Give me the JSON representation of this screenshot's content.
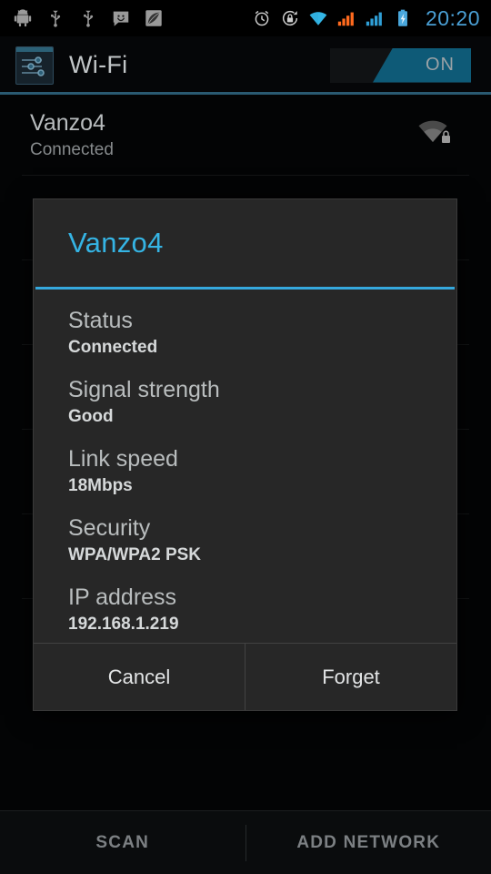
{
  "statusbar": {
    "left_icons": [
      "android-debug-icon",
      "usb-icon",
      "usb-icon-2",
      "sms-smiley-icon",
      "leaf-icon"
    ],
    "right_icons": [
      "alarm-clock-icon",
      "rotation-lock-icon",
      "wifi-signal-icon",
      "cell-signal-sim1-icon",
      "cell-signal-sim2-icon",
      "battery-charging-icon"
    ],
    "clock": "20:20",
    "clock_color": "#4a9fd4",
    "wifi_icon_color": "#33b5e5",
    "sim1_color": "#ff6a1e",
    "sim2_color": "#2f9fd6",
    "battery_color": "#4aa8dd"
  },
  "header": {
    "icon": "wifi-settings-sliders-icon",
    "title": "Wi-Fi",
    "toggle": {
      "label": "ON",
      "state": "on",
      "accent": "#0e5a77"
    },
    "divider_color": "#2a5a72"
  },
  "networks": [
    {
      "name": "Vanzo4",
      "status": "Connected",
      "icon": "wifi-lock-signal-icon",
      "secured": true
    }
  ],
  "bottombar": {
    "scan_label": "SCAN",
    "add_network_label": "ADD NETWORK"
  },
  "dialog": {
    "title": "Vanzo4",
    "title_color": "#35b4e4",
    "details": [
      {
        "label": "Status",
        "value": "Connected"
      },
      {
        "label": "Signal strength",
        "value": "Good"
      },
      {
        "label": "Link speed",
        "value": "18Mbps"
      },
      {
        "label": "Security",
        "value": "WPA/WPA2 PSK"
      },
      {
        "label": "IP address",
        "value": "192.168.1.219"
      }
    ],
    "buttons": {
      "cancel_label": "Cancel",
      "forget_label": "Forget"
    }
  }
}
